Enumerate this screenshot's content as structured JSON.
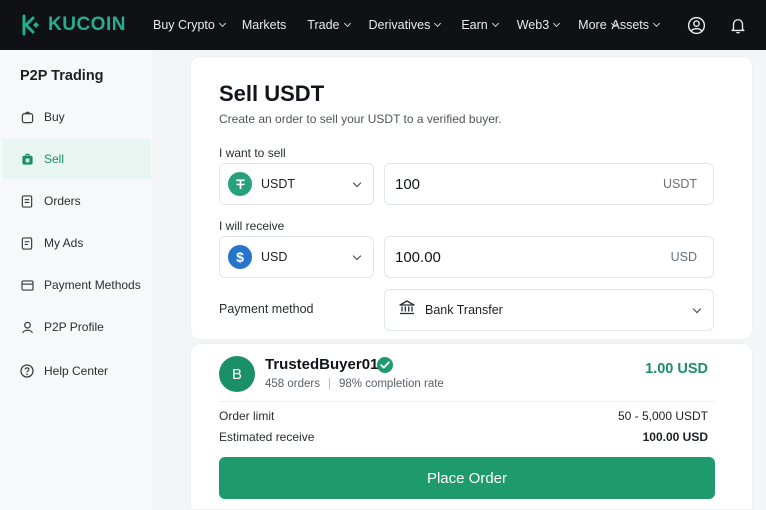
{
  "brand": {
    "name": "KUCOIN",
    "accent": "#24ae8f"
  },
  "nav": {
    "items": [
      {
        "label": "Buy Crypto",
        "has_caret": true
      },
      {
        "label": "Markets",
        "has_caret": false
      },
      {
        "label": "Trade",
        "has_caret": true
      },
      {
        "label": "Derivatives",
        "has_caret": true
      },
      {
        "label": "Earn",
        "has_caret": true
      },
      {
        "label": "Web3",
        "has_caret": true
      },
      {
        "label": "More",
        "has_caret": true
      }
    ],
    "assets_label": "Assets",
    "icons": [
      "user-circle-icon",
      "bell-icon"
    ]
  },
  "sidebar": {
    "title": "P2P Trading",
    "items": [
      {
        "label": "Buy",
        "icon": "buy-bag-icon",
        "active": false
      },
      {
        "label": "Sell",
        "icon": "sell-bag-icon",
        "active": true
      },
      {
        "label": "Orders",
        "icon": "orders-doc-icon",
        "active": false
      },
      {
        "label": "My Ads",
        "icon": "ads-doc-icon",
        "active": false
      },
      {
        "label": "Payment Methods",
        "icon": "card-icon",
        "active": false
      },
      {
        "label": "P2P Profile",
        "icon": "person-icon",
        "active": false
      },
      {
        "label": "Help Center",
        "icon": "help-icon",
        "active": false
      }
    ]
  },
  "sell_form": {
    "title": "Sell USDT",
    "subtitle": "Create an order to sell your USDT to a verified buyer.",
    "sell_label": "I want to sell",
    "sell_currency": "USDT",
    "sell_amount": "100",
    "sell_unit": "USDT",
    "receive_label": "I will receive",
    "receive_currency": "USD",
    "receive_amount": "100.00",
    "receive_unit": "USD",
    "payment_label": "Payment method",
    "payment_value": "Bank Transfer"
  },
  "offer": {
    "avatar_letter": "B",
    "seller": "TrustedBuyer01",
    "verified": true,
    "orders": "458 orders",
    "completion": "98% completion rate",
    "price": "1.00 USD",
    "limit_label": "Order limit",
    "limit_value": "50 - 5,000 USDT",
    "receive_label": "Estimated receive",
    "receive_value": "100.00 USD",
    "button": "Place Order"
  },
  "colors": {
    "primary_green": "#1f9a6d",
    "usdt_green": "#26a17b",
    "usd_blue": "#2775ca",
    "topbar": "#0f1115"
  }
}
